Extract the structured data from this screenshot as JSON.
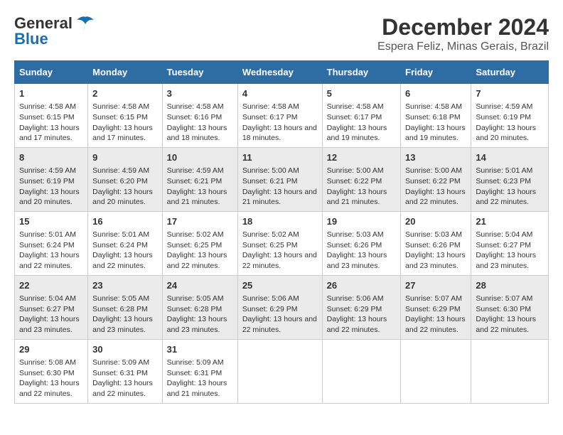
{
  "logo": {
    "line1": "General",
    "line2": "Blue"
  },
  "title": "December 2024",
  "subtitle": "Espera Feliz, Minas Gerais, Brazil",
  "days_of_week": [
    "Sunday",
    "Monday",
    "Tuesday",
    "Wednesday",
    "Thursday",
    "Friday",
    "Saturday"
  ],
  "weeks": [
    [
      {
        "day": 1,
        "sunrise": "4:58 AM",
        "sunset": "6:15 PM",
        "daylight": "13 hours and 17 minutes."
      },
      {
        "day": 2,
        "sunrise": "4:58 AM",
        "sunset": "6:15 PM",
        "daylight": "13 hours and 17 minutes."
      },
      {
        "day": 3,
        "sunrise": "4:58 AM",
        "sunset": "6:16 PM",
        "daylight": "13 hours and 18 minutes."
      },
      {
        "day": 4,
        "sunrise": "4:58 AM",
        "sunset": "6:17 PM",
        "daylight": "13 hours and 18 minutes."
      },
      {
        "day": 5,
        "sunrise": "4:58 AM",
        "sunset": "6:17 PM",
        "daylight": "13 hours and 19 minutes."
      },
      {
        "day": 6,
        "sunrise": "4:58 AM",
        "sunset": "6:18 PM",
        "daylight": "13 hours and 19 minutes."
      },
      {
        "day": 7,
        "sunrise": "4:59 AM",
        "sunset": "6:19 PM",
        "daylight": "13 hours and 20 minutes."
      }
    ],
    [
      {
        "day": 8,
        "sunrise": "4:59 AM",
        "sunset": "6:19 PM",
        "daylight": "13 hours and 20 minutes."
      },
      {
        "day": 9,
        "sunrise": "4:59 AM",
        "sunset": "6:20 PM",
        "daylight": "13 hours and 20 minutes."
      },
      {
        "day": 10,
        "sunrise": "4:59 AM",
        "sunset": "6:21 PM",
        "daylight": "13 hours and 21 minutes."
      },
      {
        "day": 11,
        "sunrise": "5:00 AM",
        "sunset": "6:21 PM",
        "daylight": "13 hours and 21 minutes."
      },
      {
        "day": 12,
        "sunrise": "5:00 AM",
        "sunset": "6:22 PM",
        "daylight": "13 hours and 21 minutes."
      },
      {
        "day": 13,
        "sunrise": "5:00 AM",
        "sunset": "6:22 PM",
        "daylight": "13 hours and 22 minutes."
      },
      {
        "day": 14,
        "sunrise": "5:01 AM",
        "sunset": "6:23 PM",
        "daylight": "13 hours and 22 minutes."
      }
    ],
    [
      {
        "day": 15,
        "sunrise": "5:01 AM",
        "sunset": "6:24 PM",
        "daylight": "13 hours and 22 minutes."
      },
      {
        "day": 16,
        "sunrise": "5:01 AM",
        "sunset": "6:24 PM",
        "daylight": "13 hours and 22 minutes."
      },
      {
        "day": 17,
        "sunrise": "5:02 AM",
        "sunset": "6:25 PM",
        "daylight": "13 hours and 22 minutes."
      },
      {
        "day": 18,
        "sunrise": "5:02 AM",
        "sunset": "6:25 PM",
        "daylight": "13 hours and 22 minutes."
      },
      {
        "day": 19,
        "sunrise": "5:03 AM",
        "sunset": "6:26 PM",
        "daylight": "13 hours and 23 minutes."
      },
      {
        "day": 20,
        "sunrise": "5:03 AM",
        "sunset": "6:26 PM",
        "daylight": "13 hours and 23 minutes."
      },
      {
        "day": 21,
        "sunrise": "5:04 AM",
        "sunset": "6:27 PM",
        "daylight": "13 hours and 23 minutes."
      }
    ],
    [
      {
        "day": 22,
        "sunrise": "5:04 AM",
        "sunset": "6:27 PM",
        "daylight": "13 hours and 23 minutes."
      },
      {
        "day": 23,
        "sunrise": "5:05 AM",
        "sunset": "6:28 PM",
        "daylight": "13 hours and 23 minutes."
      },
      {
        "day": 24,
        "sunrise": "5:05 AM",
        "sunset": "6:28 PM",
        "daylight": "13 hours and 23 minutes."
      },
      {
        "day": 25,
        "sunrise": "5:06 AM",
        "sunset": "6:29 PM",
        "daylight": "13 hours and 22 minutes."
      },
      {
        "day": 26,
        "sunrise": "5:06 AM",
        "sunset": "6:29 PM",
        "daylight": "13 hours and 22 minutes."
      },
      {
        "day": 27,
        "sunrise": "5:07 AM",
        "sunset": "6:29 PM",
        "daylight": "13 hours and 22 minutes."
      },
      {
        "day": 28,
        "sunrise": "5:07 AM",
        "sunset": "6:30 PM",
        "daylight": "13 hours and 22 minutes."
      }
    ],
    [
      {
        "day": 29,
        "sunrise": "5:08 AM",
        "sunset": "6:30 PM",
        "daylight": "13 hours and 22 minutes."
      },
      {
        "day": 30,
        "sunrise": "5:09 AM",
        "sunset": "6:31 PM",
        "daylight": "13 hours and 22 minutes."
      },
      {
        "day": 31,
        "sunrise": "5:09 AM",
        "sunset": "6:31 PM",
        "daylight": "13 hours and 21 minutes."
      },
      null,
      null,
      null,
      null
    ]
  ]
}
